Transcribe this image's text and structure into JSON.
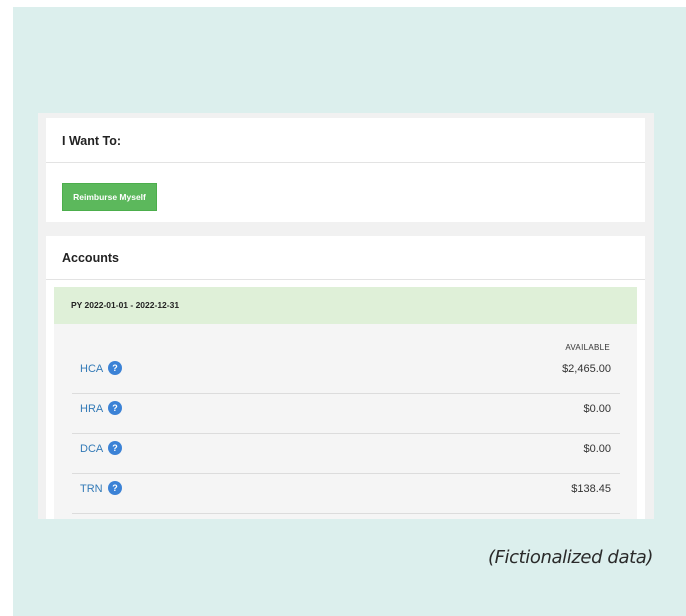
{
  "want_section": {
    "title": "I Want To:",
    "reimburse_label": "Reimburse Myself"
  },
  "accounts_section": {
    "title": "Accounts",
    "plan_year": "PY 2022-01-01 - 2022-12-31",
    "available_header": "AVAILABLE",
    "help_glyph": "?",
    "accounts": [
      {
        "name": "HCA",
        "amount": "$2,465.00"
      },
      {
        "name": "HRA",
        "amount": "$0.00"
      },
      {
        "name": "DCA",
        "amount": "$0.00"
      },
      {
        "name": "TRN",
        "amount": "$138.45"
      }
    ]
  },
  "footnote": "(Fictionalized data)",
  "colors": {
    "backdrop": "#dcefed",
    "button": "#5cb85c",
    "plan_header": "#dff0d8",
    "link": "#337ab7",
    "help_icon": "#3b82d6"
  }
}
